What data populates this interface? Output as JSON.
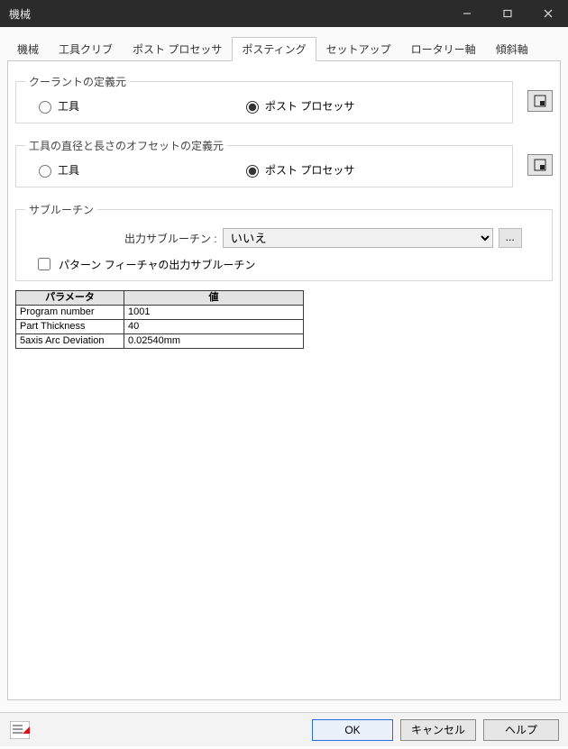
{
  "window": {
    "title": "機械"
  },
  "tabs": [
    {
      "label": "機械"
    },
    {
      "label": "工具クリブ"
    },
    {
      "label": "ポスト プロセッサ"
    },
    {
      "label": "ポスティング"
    },
    {
      "label": "セットアップ"
    },
    {
      "label": "ロータリー軸"
    },
    {
      "label": "傾斜軸"
    }
  ],
  "active_tab_index": 3,
  "coolant": {
    "legend": "クーラントの定義元",
    "opt_tool": "工具",
    "opt_post": "ポスト プロセッサ",
    "selected": "post"
  },
  "offset": {
    "legend": "工具の直径と長さのオフセットの定義元",
    "opt_tool": "工具",
    "opt_post": "ポスト プロセッサ",
    "selected": "post"
  },
  "subroutine": {
    "legend": "サブルーチン",
    "output_label": "出力サブルーチン :",
    "select_value": "いいえ",
    "pattern_checkbox_label": "パターン フィーチャの出力サブルーチン",
    "pattern_checked": false
  },
  "params": {
    "header_param": "パラメータ",
    "header_value": "値",
    "rows": [
      {
        "name": "Program number",
        "value": "1001"
      },
      {
        "name": "Part Thickness",
        "value": "40"
      },
      {
        "name": "5axis Arc Deviation",
        "value": "0.02540mm"
      }
    ]
  },
  "buttons": {
    "ok": "OK",
    "cancel": "キャンセル",
    "help": "ヘルプ",
    "ellipsis": "..."
  },
  "icons": {
    "side_config": "config-icon"
  }
}
